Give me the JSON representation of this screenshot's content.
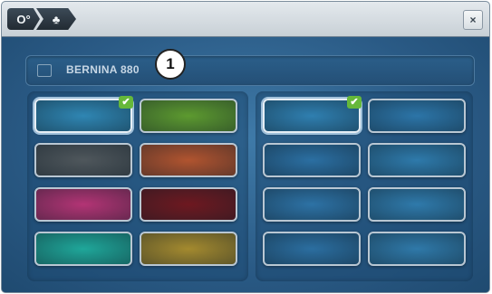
{
  "titlebar": {
    "crumbs": [
      {
        "icon": "settings-icon",
        "label": "O°"
      },
      {
        "icon": "user-icon",
        "label": "♣"
      }
    ],
    "close_label": "×"
  },
  "name_field": {
    "value": "BERNINA 880"
  },
  "callout": {
    "label": "1"
  },
  "themes": {
    "left": [
      {
        "name": "blue",
        "color": "#2f86b3",
        "selected": true
      },
      {
        "name": "green",
        "color": "#5d9a2f",
        "selected": false
      },
      {
        "name": "graphite",
        "color": "#4f575c",
        "selected": false
      },
      {
        "name": "rust",
        "color": "#b1542f",
        "selected": false
      },
      {
        "name": "magenta",
        "color": "#b33475",
        "selected": false
      },
      {
        "name": "crimson",
        "color": "#6e1820",
        "selected": false
      },
      {
        "name": "teal",
        "color": "#1fa79a",
        "selected": false
      },
      {
        "name": "gold",
        "color": "#a48a2e",
        "selected": false
      }
    ],
    "right": [
      {
        "name": "blue-plain",
        "color": "#2f7fb0",
        "selected": true
      },
      {
        "name": "blue-texture-2",
        "color": "#2c75a8",
        "selected": false
      },
      {
        "name": "blue-texture-3",
        "color": "#2b6fa2",
        "selected": false
      },
      {
        "name": "blue-texture-4",
        "color": "#2e7aab",
        "selected": false
      },
      {
        "name": "blue-texture-5",
        "color": "#2d72a5",
        "selected": false
      },
      {
        "name": "blue-texture-6",
        "color": "#2f7aab",
        "selected": false
      },
      {
        "name": "blue-texture-7",
        "color": "#2b6ea0",
        "selected": false
      },
      {
        "name": "blue-texture-8",
        "color": "#2f79a9",
        "selected": false
      }
    ]
  },
  "check_glyph": "✔"
}
